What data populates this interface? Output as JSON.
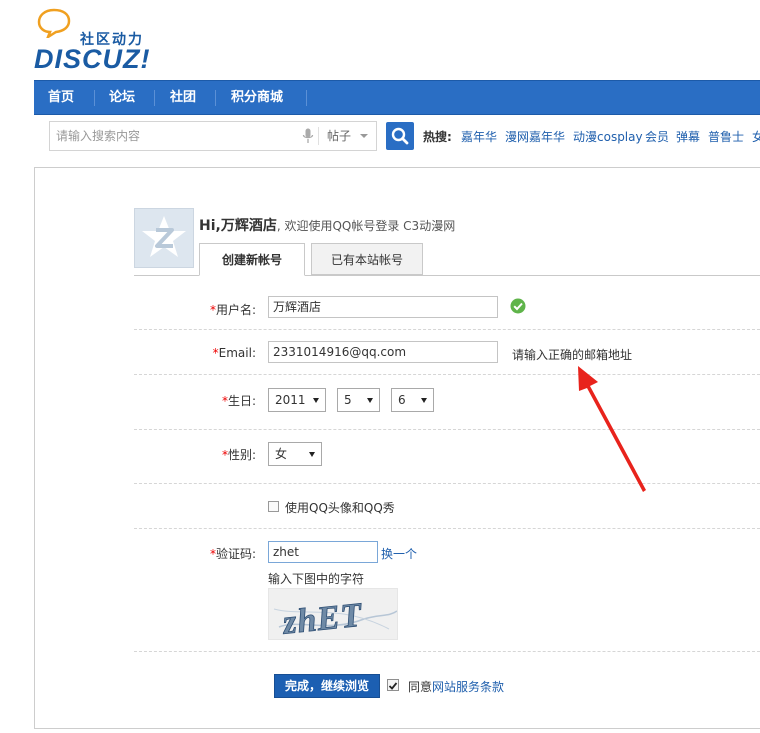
{
  "logo": {
    "slogan": "社区动力",
    "text": "DISCUZ!"
  },
  "nav": {
    "items": [
      "首页",
      "论坛",
      "社团",
      "积分商城"
    ]
  },
  "search": {
    "placeholder": "请输入搜索内容",
    "type": "帖子"
  },
  "hot": {
    "label": "热搜:",
    "items": [
      "嘉年华",
      "漫网嘉年华",
      "动漫cosplay",
      "会员",
      "弹幕",
      "普鲁士",
      "女"
    ]
  },
  "greeting": {
    "name": "Hi,万辉酒店",
    "rest": ", 欢迎使用QQ帐号登录 C3动漫网"
  },
  "tabs": {
    "create": "创建新帐号",
    "existing": "已有本站帐号"
  },
  "form": {
    "username": {
      "label": "用户名:",
      "value": "万辉酒店"
    },
    "email": {
      "label": "Email:",
      "value": "2331014916@qq.com",
      "hint": "请输入正确的邮箱地址"
    },
    "birthday": {
      "label": "生日:",
      "year": "2011",
      "month": "5",
      "day": "6"
    },
    "gender": {
      "label": "性别:",
      "value": "女"
    },
    "qqshow": {
      "label": "使用QQ头像和QQ秀",
      "checked": false
    },
    "captcha": {
      "label": "验证码:",
      "value": "zhet",
      "refresh": "换一个",
      "hint": "输入下图中的字符",
      "image_text": "zhET"
    },
    "required_mark": "*"
  },
  "submit": {
    "label": "完成，继续浏览"
  },
  "agree": {
    "prefix": "同意",
    "link": "网站服务条款",
    "checked": true
  },
  "colors": {
    "nav_bg": "#2a6ec4",
    "link": "#1f5fad",
    "required": "#ee0000",
    "arrow": "#e8231c"
  }
}
